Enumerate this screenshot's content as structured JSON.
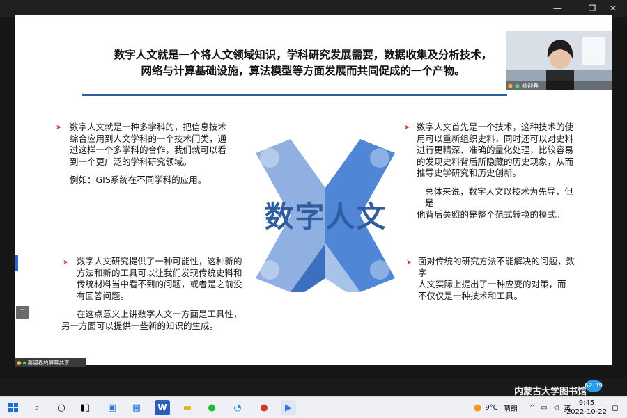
{
  "slide": {
    "title_line1": "数字人文就是一个将人文领域知识，学科研究发展需要，数据收集及分析技术，",
    "title_line2": "网络与计算基础设施，算法模型等方面发展而共同促成的一个产物。",
    "center_label": "数字人文",
    "top_left": {
      "line1": "数字人文就是一种多学科的，把信息技术",
      "line2": "综合应用到人文学科的一个技术门类，通",
      "line3": "过这样一个多学科的合作，我们就可以看",
      "line4": "到一个更广泛的学科研究领域。",
      "example": "例如：GIS系统在不同学科的应用。"
    },
    "top_right": {
      "line1": "数字人文首先是一个技术，这种技术的使",
      "line2": "用可以重新组织史料，同时还可以对史料",
      "line3": "进行更精深、准确的量化处理，比较容易",
      "line4": "的发现史料背后所隐藏的历史现象，从而",
      "line5": "推导史学研究和历史创新。",
      "summary1": "总体来说，数字人文以技术为先导，但是",
      "summary2": "他背后关照的是整个范式转换的模式。"
    },
    "bottom_left": {
      "line1": "数字人文研究提供了一种可能性，这种新的",
      "line2": "方法和新的工具可以让我们发现传统史料和",
      "line3": "传统材料当中看不到的问题，或者是之前没",
      "line4": "有回答问题。",
      "summary1": "在这点意义上讲数字人文一方面是工具性，",
      "summary2": "另一方面可以提供一些新的知识的生成。"
    },
    "bottom_right": {
      "line1": "面对传统的研究方法不能解决的问题，数字",
      "line2": "人文实际上提出了一种应变的对策，而",
      "line3": "不仅仅是一种技术和工具。"
    }
  },
  "video": {
    "participant_name": "蔡迎春"
  },
  "share_bar": {
    "label": "蔡迎春的屏幕共享"
  },
  "watermark": {
    "text": "内蒙古大学图书馆"
  },
  "timer_badge": "62:39",
  "taskbar": {
    "weather_temp": "9°C",
    "weather_desc": "晴朗",
    "time": "9:45",
    "date": "2022-10-22"
  },
  "colors": {
    "accent_blue": "#2e5da0",
    "light_blue": "#8fb0e0",
    "mid_blue": "#4f86d6",
    "bullet_red": "#d9342b"
  }
}
